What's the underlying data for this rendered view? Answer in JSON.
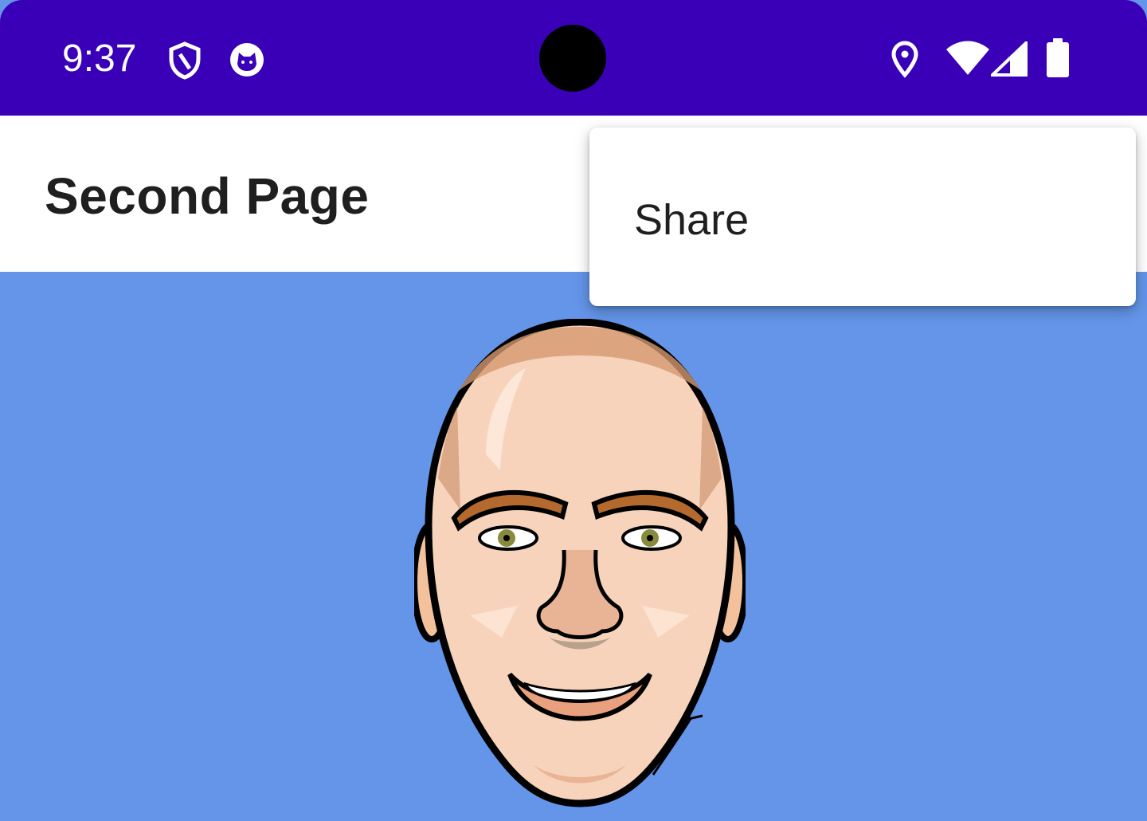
{
  "status_bar": {
    "time": "9:37",
    "left_icons": [
      "shield-icon",
      "cat-app-icon"
    ],
    "right_icons": [
      "location-pin-icon",
      "wifi-icon",
      "cellular-signal-icon",
      "battery-icon"
    ],
    "color": "#3900b7"
  },
  "app_bar": {
    "title": "Second Page"
  },
  "overflow_menu": {
    "items": [
      {
        "label": "Share"
      }
    ]
  },
  "content": {
    "background_color": "#6495e9",
    "image": "cartoon-face-caricature"
  }
}
